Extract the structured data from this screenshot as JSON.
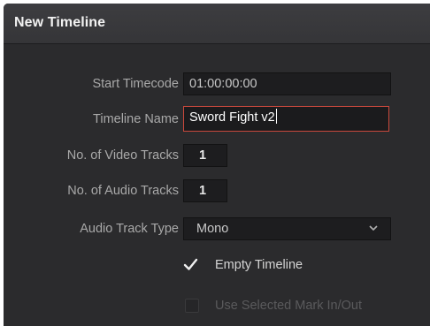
{
  "dialog": {
    "title": "New Timeline"
  },
  "form": {
    "start_timecode": {
      "label": "Start Timecode",
      "value": "01:00:00:00"
    },
    "timeline_name": {
      "label": "Timeline Name",
      "value": "Sword Fight v2"
    },
    "video_tracks": {
      "label": "No. of Video Tracks",
      "value": "1"
    },
    "audio_tracks": {
      "label": "No. of Audio Tracks",
      "value": "1"
    },
    "audio_track_type": {
      "label": "Audio Track Type",
      "value": "Mono"
    },
    "empty_timeline": {
      "label": "Empty Timeline",
      "checked": true,
      "enabled": true
    },
    "use_selected_mark": {
      "label": "Use Selected Mark In/Out",
      "checked": false,
      "enabled": false
    }
  },
  "icons": {
    "dropdown": "chevron-down-icon",
    "check": "checkmark-icon"
  },
  "colors": {
    "background": "#2b2b2d",
    "focus_border": "#c8483c",
    "label_text": "#a9a9a9",
    "disabled_text": "#5a5a5c"
  }
}
